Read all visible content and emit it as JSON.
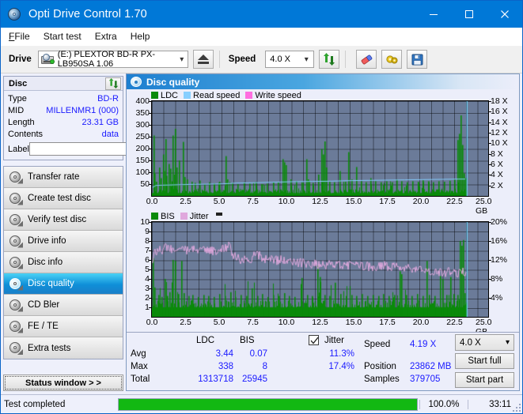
{
  "window": {
    "title": "Opti Drive Control 1.70",
    "icon": "disc-icon",
    "minimize": "minimize-icon",
    "maximize": "maximize-icon",
    "close": "close-icon"
  },
  "menu": {
    "items": [
      "File",
      "Start test",
      "Extra",
      "Help"
    ]
  },
  "toolbar": {
    "drive_label": "Drive",
    "drive_value": "(E:)   PLEXTOR BD-R  PX-LB950SA 1.06",
    "eject_title": "eject-button",
    "speed_label": "Speed",
    "speed_value": "4.0 X",
    "refresh_title": "refresh-button",
    "erase_title": "erase-button",
    "settings_title": "settings-button",
    "save_title": "save-button"
  },
  "disc_panel": {
    "header": "Disc",
    "refresh": "refresh-icon",
    "rows": [
      {
        "key": "Type",
        "value": "BD-R"
      },
      {
        "key": "MID",
        "value": "MILLENMR1 (000)"
      },
      {
        "key": "Length",
        "value": "23.31 GB"
      },
      {
        "key": "Contents",
        "value": "data"
      }
    ],
    "label_key": "Label",
    "label_value": "",
    "label_placeholder": ""
  },
  "nav": {
    "items": [
      {
        "label": "Transfer rate",
        "selected": false
      },
      {
        "label": "Create test disc",
        "selected": false
      },
      {
        "label": "Verify test disc",
        "selected": false
      },
      {
        "label": "Drive info",
        "selected": false
      },
      {
        "label": "Disc info",
        "selected": false
      },
      {
        "label": "Disc quality",
        "selected": true
      },
      {
        "label": "CD Bler",
        "selected": false
      },
      {
        "label": "FE / TE",
        "selected": false
      },
      {
        "label": "Extra tests",
        "selected": false
      }
    ],
    "status_window": "Status window > >"
  },
  "main": {
    "title": "Disc quality",
    "icon": "disc-quality-icon"
  },
  "chart_data": [
    {
      "id": "ldc-chart",
      "type": "bar",
      "title": "LDC / Read speed",
      "legend": [
        {
          "label": "LDC",
          "color": "#0a8a0a"
        },
        {
          "label": "Read speed",
          "color": "#87cfff"
        },
        {
          "label": "Write speed",
          "color": "#ff6ee0"
        }
      ],
      "legend_position": "top-left",
      "xlabel": "GB",
      "xlim": [
        0,
        25
      ],
      "xticks": [
        0.0,
        2.5,
        5.0,
        7.5,
        10.0,
        12.5,
        15.0,
        17.5,
        20.0,
        22.5,
        25.0
      ],
      "xticklabels": [
        "0.0",
        "2.5",
        "5.0",
        "7.5",
        "10.0",
        "12.5",
        "15.0",
        "17.5",
        "20.0",
        "22.5",
        "25.0"
      ],
      "xunit": "GB",
      "ylabel": "LDC",
      "ylim": [
        0,
        400
      ],
      "yticks": [
        50,
        100,
        150,
        200,
        250,
        300,
        350,
        400
      ],
      "y2label": "Speed",
      "y2lim": [
        0,
        18
      ],
      "y2ticks": [
        2,
        4,
        6,
        8,
        10,
        12,
        14,
        16,
        18
      ],
      "y2ticklabels": [
        "2 X",
        "4 X",
        "6 X",
        "8 X",
        "10 X",
        "12 X",
        "14 X",
        "16 X",
        "18 X"
      ],
      "grid": true,
      "data_end_gb": 23.4,
      "baseline_ldc": 22,
      "ldc_spikes": [
        [
          0.1,
          255
        ],
        [
          0.18,
          95
        ],
        [
          0.3,
          60
        ],
        [
          0.55,
          120
        ],
        [
          0.62,
          75
        ],
        [
          0.8,
          175
        ],
        [
          0.88,
          105
        ],
        [
          1.0,
          240
        ],
        [
          1.08,
          85
        ],
        [
          1.22,
          135
        ],
        [
          1.35,
          115
        ],
        [
          1.55,
          255
        ],
        [
          1.62,
          90
        ],
        [
          1.72,
          283
        ],
        [
          1.8,
          120
        ],
        [
          2.0,
          150
        ],
        [
          2.3,
          228
        ],
        [
          2.4,
          80
        ],
        [
          2.6,
          70
        ],
        [
          2.95,
          60
        ],
        [
          3.2,
          55
        ],
        [
          3.55,
          65
        ],
        [
          3.9,
          50
        ],
        [
          4.25,
          58
        ],
        [
          4.6,
          52
        ],
        [
          5.0,
          60
        ],
        [
          5.45,
          168
        ],
        [
          5.6,
          70
        ],
        [
          5.95,
          55
        ],
        [
          6.35,
          50
        ],
        [
          6.8,
          58
        ],
        [
          7.25,
          52
        ],
        [
          7.7,
          55
        ],
        [
          8.1,
          50
        ],
        [
          8.55,
          52
        ],
        [
          9.0,
          58
        ],
        [
          9.35,
          60
        ],
        [
          9.7,
          155
        ],
        [
          9.82,
          142
        ],
        [
          9.95,
          130
        ],
        [
          10.3,
          70
        ],
        [
          10.7,
          62
        ],
        [
          11.1,
          58
        ],
        [
          11.45,
          155
        ],
        [
          11.6,
          70
        ],
        [
          11.95,
          55
        ],
        [
          12.35,
          90
        ],
        [
          12.6,
          198
        ],
        [
          12.72,
          175
        ],
        [
          12.85,
          230
        ],
        [
          12.95,
          120
        ],
        [
          13.2,
          62
        ],
        [
          13.55,
          58
        ],
        [
          13.95,
          105
        ],
        [
          14.35,
          60
        ],
        [
          14.6,
          185
        ],
        [
          14.8,
          70
        ],
        [
          15.15,
          122
        ],
        [
          15.5,
          62
        ],
        [
          15.9,
          58
        ],
        [
          16.25,
          75
        ],
        [
          16.6,
          62
        ],
        [
          17.0,
          58
        ],
        [
          17.4,
          62
        ],
        [
          17.8,
          58
        ],
        [
          18.2,
          70
        ],
        [
          18.55,
          62
        ],
        [
          18.95,
          58
        ],
        [
          19.35,
          62
        ],
        [
          19.75,
          60
        ],
        [
          20.1,
          66
        ],
        [
          20.5,
          62
        ],
        [
          20.9,
          58
        ],
        [
          21.3,
          62
        ],
        [
          21.7,
          60
        ],
        [
          22.1,
          64
        ],
        [
          22.45,
          70
        ],
        [
          22.7,
          236
        ],
        [
          22.82,
          262
        ],
        [
          22.95,
          340
        ],
        [
          23.05,
          215
        ],
        [
          23.18,
          95
        ],
        [
          23.3,
          75
        ]
      ],
      "read_speed_line": [
        [
          0.05,
          1.6
        ],
        [
          0.3,
          2.0
        ],
        [
          0.8,
          2.05
        ],
        [
          1.6,
          2.1
        ],
        [
          2.3,
          2.15
        ],
        [
          3.2,
          2.2
        ],
        [
          4.4,
          2.25
        ],
        [
          5.3,
          2.3
        ],
        [
          6.3,
          2.45
        ],
        [
          7.6,
          2.5
        ],
        [
          8.9,
          2.6
        ],
        [
          10.4,
          2.7
        ],
        [
          11.9,
          2.75
        ],
        [
          13.3,
          2.8
        ],
        [
          14.7,
          2.9
        ],
        [
          16.0,
          2.95
        ],
        [
          17.4,
          3.0
        ],
        [
          18.8,
          3.05
        ],
        [
          20.1,
          3.1
        ],
        [
          21.5,
          3.15
        ],
        [
          22.8,
          3.2
        ],
        [
          23.3,
          3.2
        ]
      ],
      "cursor_gb": 23.4
    },
    {
      "id": "bis-chart",
      "type": "bar",
      "title": "BIS / Jitter",
      "legend": [
        {
          "label": "BIS",
          "color": "#0a8a0a"
        },
        {
          "label": "Jitter",
          "color": "#e0a8dd"
        }
      ],
      "legend_position": "top-left",
      "xlabel": "GB",
      "xlim": [
        0,
        25
      ],
      "xticks": [
        0.0,
        2.5,
        5.0,
        7.5,
        10.0,
        12.5,
        15.0,
        17.5,
        20.0,
        22.5,
        25.0
      ],
      "xticklabels": [
        "0.0",
        "2.5",
        "5.0",
        "7.5",
        "10.0",
        "12.5",
        "15.0",
        "17.5",
        "20.0",
        "22.5",
        "25.0"
      ],
      "xunit": "GB",
      "ylabel": "BIS",
      "ylim": [
        0,
        10
      ],
      "yticks": [
        1,
        2,
        3,
        4,
        5,
        6,
        7,
        8,
        9,
        10
      ],
      "y2label": "Jitter",
      "y2lim": [
        0,
        20
      ],
      "y2ticks": [
        4,
        8,
        12,
        16,
        20
      ],
      "y2ticklabels": [
        "4%",
        "8%",
        "12%",
        "16%",
        "20%"
      ],
      "grid": true,
      "data_end_gb": 23.4,
      "baseline_bis": 1.35,
      "bis_spikes": [
        [
          0.08,
          6.2
        ],
        [
          0.2,
          3.1
        ],
        [
          0.45,
          2.3
        ],
        [
          0.7,
          2.1
        ],
        [
          0.95,
          4.0
        ],
        [
          1.1,
          2.2
        ],
        [
          1.3,
          2.6
        ],
        [
          1.55,
          6.0
        ],
        [
          1.7,
          5.9
        ],
        [
          1.95,
          2.4
        ],
        [
          2.2,
          5.9
        ],
        [
          2.35,
          2.5
        ],
        [
          2.7,
          2.2
        ],
        [
          3.0,
          2.3
        ],
        [
          3.4,
          2.1
        ],
        [
          3.8,
          2.3
        ],
        [
          4.2,
          2.2
        ],
        [
          4.6,
          2.1
        ],
        [
          5.0,
          2.4
        ],
        [
          5.4,
          2.2
        ],
        [
          5.8,
          2.6
        ],
        [
          6.2,
          2.1
        ],
        [
          6.6,
          2.3
        ],
        [
          7.0,
          2.2
        ],
        [
          7.4,
          3.0
        ],
        [
          7.8,
          2.2
        ],
        [
          8.2,
          2.4
        ],
        [
          8.6,
          2.1
        ],
        [
          9.0,
          2.3
        ],
        [
          9.4,
          2.2
        ],
        [
          9.8,
          2.5
        ],
        [
          10.2,
          2.2
        ],
        [
          10.6,
          2.1
        ],
        [
          11.1,
          4.1
        ],
        [
          11.5,
          2.3
        ],
        [
          11.9,
          2.2
        ],
        [
          12.3,
          5.4
        ],
        [
          12.45,
          4.2
        ],
        [
          12.8,
          2.3
        ],
        [
          13.2,
          2.2
        ],
        [
          13.6,
          3.6
        ],
        [
          14.0,
          2.4
        ],
        [
          14.4,
          2.2
        ],
        [
          14.8,
          2.3
        ],
        [
          15.2,
          2.2
        ],
        [
          15.6,
          2.4
        ],
        [
          16.0,
          2.2
        ],
        [
          16.4,
          2.3
        ],
        [
          16.8,
          2.2
        ],
        [
          17.2,
          2.4
        ],
        [
          17.6,
          2.2
        ],
        [
          18.0,
          2.3
        ],
        [
          18.4,
          4.8
        ],
        [
          18.55,
          4.5
        ],
        [
          18.9,
          2.3
        ],
        [
          19.3,
          2.2
        ],
        [
          19.7,
          2.4
        ],
        [
          20.1,
          2.2
        ],
        [
          20.4,
          5.9
        ],
        [
          20.6,
          2.3
        ],
        [
          21.0,
          2.2
        ],
        [
          21.4,
          4.3
        ],
        [
          21.6,
          4.0
        ],
        [
          21.9,
          2.3
        ],
        [
          22.2,
          4.2
        ],
        [
          22.4,
          2.4
        ],
        [
          22.7,
          2.3
        ],
        [
          22.9,
          8.0
        ],
        [
          23.0,
          7.5
        ],
        [
          23.1,
          8.1
        ],
        [
          23.25,
          2.5
        ]
      ],
      "jitter_avg_pct": 11.3,
      "jitter_max_pct": 17.4,
      "jitter_line": [
        [
          0.05,
          12.0
        ],
        [
          0.3,
          13.8
        ],
        [
          0.7,
          14.0
        ],
        [
          1.1,
          14.6
        ],
        [
          1.55,
          14.3
        ],
        [
          2.0,
          14.5
        ],
        [
          2.45,
          14.2
        ],
        [
          2.9,
          13.9
        ],
        [
          3.4,
          14.2
        ],
        [
          3.9,
          13.8
        ],
        [
          4.4,
          14.0
        ],
        [
          4.9,
          13.9
        ],
        [
          5.4,
          14.3
        ],
        [
          5.7,
          15.2
        ],
        [
          6.0,
          13.1
        ],
        [
          6.4,
          12.2
        ],
        [
          6.9,
          12.0
        ],
        [
          7.4,
          12.1
        ],
        [
          7.8,
          13.5
        ],
        [
          8.2,
          12.2
        ],
        [
          8.7,
          12.1
        ],
        [
          9.2,
          11.9
        ],
        [
          9.7,
          12.0
        ],
        [
          10.2,
          11.6
        ],
        [
          10.7,
          11.5
        ],
        [
          11.2,
          11.4
        ],
        [
          11.7,
          11.2
        ],
        [
          12.2,
          11.0
        ],
        [
          12.7,
          11.0
        ],
        [
          13.2,
          10.9
        ],
        [
          13.8,
          10.8
        ],
        [
          14.4,
          10.9
        ],
        [
          15.0,
          10.7
        ],
        [
          15.6,
          10.7
        ],
        [
          16.2,
          10.6
        ],
        [
          16.8,
          10.6
        ],
        [
          17.4,
          10.8
        ],
        [
          18.0,
          10.5
        ],
        [
          18.6,
          10.4
        ],
        [
          19.2,
          10.3
        ],
        [
          19.8,
          10.2
        ],
        [
          20.4,
          10.1
        ],
        [
          21.0,
          9.4
        ],
        [
          21.5,
          9.2
        ],
        [
          22.0,
          9.5
        ],
        [
          22.5,
          9.4
        ],
        [
          23.0,
          9.3
        ],
        [
          23.3,
          9.6
        ]
      ],
      "cursor_gb": 23.4
    }
  ],
  "stats": {
    "col_ldc": "LDC",
    "col_bis": "BIS",
    "jitter_label": "Jitter",
    "jitter_checked": true,
    "rows": [
      {
        "name": "Avg",
        "ldc": "3.44",
        "bis": "0.07",
        "jitter": "11.3%"
      },
      {
        "name": "Max",
        "ldc": "338",
        "bis": "8",
        "jitter": "17.4%"
      },
      {
        "name": "Total",
        "ldc": "1313718",
        "bis": "25945",
        "jitter": ""
      }
    ],
    "speed_label": "Speed",
    "speed_value": "4.19 X",
    "position_label": "Position",
    "position_value": "23862 MB",
    "samples_label": "Samples",
    "samples_value": "379705",
    "speed_select": "4.0 X",
    "start_full": "Start full",
    "start_part": "Start part"
  },
  "statusbar": {
    "message": "Test completed",
    "progress_percent": 100,
    "progress_text": "100.0%",
    "elapsed": "33:11"
  },
  "colors": {
    "accent": "#0078d7",
    "value_text": "#1a1aff",
    "ldc_green": "#0a8a0a",
    "read_speed": "#87cfff",
    "write_speed": "#ff6ee0",
    "jitter_pink": "#e0a8dd",
    "plot_bg": "#6b7b99",
    "progress_green": "#12b812"
  }
}
